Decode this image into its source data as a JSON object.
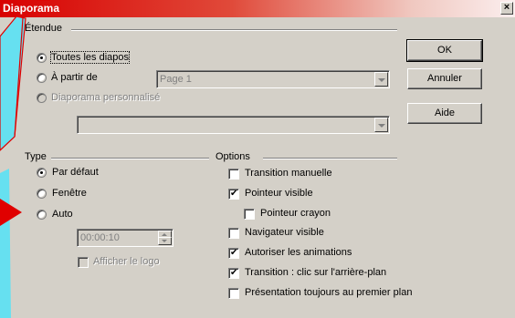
{
  "window": {
    "title": "Diaporama",
    "close_glyph": "×"
  },
  "etendue": {
    "label": "Étendue",
    "options": [
      {
        "label": "Toutes les diapos",
        "checked": true,
        "disabled": false
      },
      {
        "label": "À partir de",
        "checked": false,
        "disabled": false
      },
      {
        "label": "Diaporama personnalisé",
        "checked": false,
        "disabled": true
      }
    ],
    "start_slide": "Page 1",
    "custom_show": ""
  },
  "type": {
    "label": "Type",
    "options": [
      {
        "label": "Par défaut",
        "checked": true
      },
      {
        "label": "Fenêtre",
        "checked": false
      },
      {
        "label": "Auto",
        "checked": false
      }
    ],
    "pause": "00:00:10",
    "show_logo": "Afficher le logo"
  },
  "options": {
    "label": "Options",
    "items": [
      {
        "label": "Transition manuelle",
        "checked": false
      },
      {
        "label": "Pointeur visible",
        "checked": true
      },
      {
        "label": "Pointeur crayon",
        "checked": false
      },
      {
        "label": "Navigateur visible",
        "checked": false
      },
      {
        "label": "Autoriser les animations",
        "checked": true
      },
      {
        "label": "Transition : clic sur l'arrière-plan",
        "checked": true
      },
      {
        "label": "Présentation toujours au premier plan",
        "checked": false
      }
    ]
  },
  "buttons": {
    "ok": "OK",
    "cancel": "Annuler",
    "help": "Aide"
  },
  "colors": {
    "titlebar_start": "#d80000",
    "dialog_bg": "#d4d0c8",
    "deco_cyan": "#66e0f0",
    "deco_red": "#e00000"
  }
}
